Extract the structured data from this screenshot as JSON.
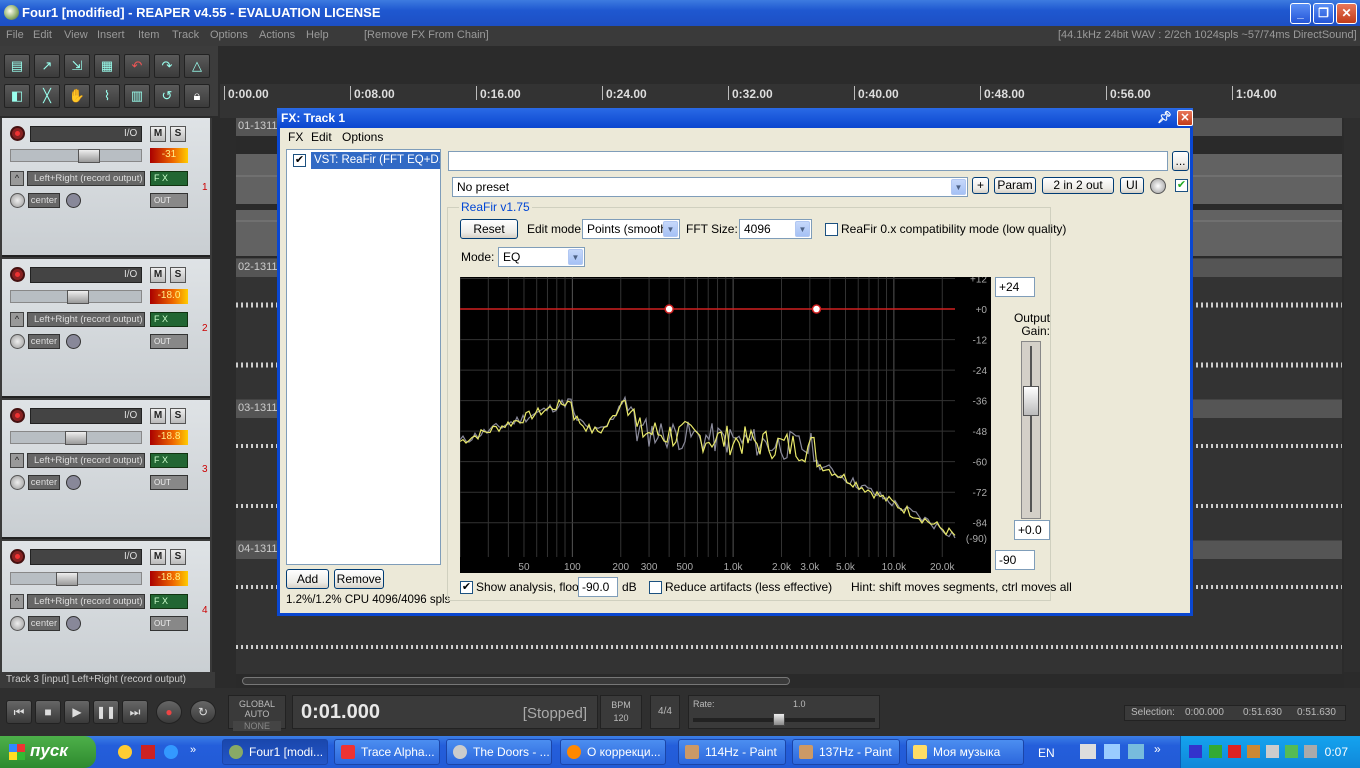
{
  "window": {
    "title": "Four1 [modified] - REAPER v4.55 - EVALUATION LICENSE"
  },
  "menu": {
    "items": [
      "File",
      "Edit",
      "View",
      "Insert",
      "Item",
      "Track",
      "Options",
      "Actions",
      "Help"
    ],
    "last_action": "[Remove FX From Chain]",
    "status": "[44.1kHz 24bit WAV : 2/2ch 1024spls ~57/74ms DirectSound]"
  },
  "ruler": {
    "ticks": [
      "0:00.00",
      "0:08.00",
      "0:16.00",
      "0:24.00",
      "0:32.00",
      "0:40.00",
      "0:48.00",
      "0:56.00",
      "1:04.00"
    ]
  },
  "clips": [
    "01-1311",
    "02-1311",
    "03-1311",
    "04-1311"
  ],
  "tracks": [
    {
      "num": "1",
      "io": "I/O",
      "mute": "M",
      "solo": "S",
      "vu": "-31",
      "routing": "Left+Right (record output)",
      "fx": "F X",
      "pan": "center",
      "out": "OUT",
      "fader": 0.62
    },
    {
      "num": "2",
      "io": "I/O",
      "mute": "M",
      "solo": "S",
      "vu": "-18.0",
      "routing": "Left+Right (record output)",
      "fx": "F X",
      "pan": "center",
      "out": "OUT",
      "fader": 0.52
    },
    {
      "num": "3",
      "io": "I/O",
      "mute": "M",
      "solo": "S",
      "vu": "-18.8",
      "routing": "Left+Right (record output)",
      "fx": "F X",
      "pan": "center",
      "out": "OUT",
      "fader": 0.5
    },
    {
      "num": "4",
      "io": "I/O",
      "mute": "M",
      "solo": "S",
      "vu": "-18.8",
      "routing": "Left+Right (record output)",
      "fx": "F X",
      "pan": "center",
      "out": "OUT",
      "fader": 0.42
    }
  ],
  "track_status": "Track 3 [input] Left+Right (record output)",
  "transport": {
    "time": "0:01.000",
    "state": "[Stopped]",
    "bpm_label": "BPM",
    "bpm": "120",
    "timesig": "4/4",
    "rate_label": "Rate:",
    "rate": "1.0",
    "global_auto": "GLOBAL AUTO",
    "global_auto_val": "NONE",
    "sel_label": "Selection:",
    "sel_start": "0:00.000",
    "sel_end": "0:51.630",
    "sel_len": "0:51.630"
  },
  "fx": {
    "title": "FX: Track 1",
    "menu": [
      "FX",
      "Edit",
      "Options"
    ],
    "chain_item": "VST: ReaFir (FFT EQ+D...",
    "add": "Add",
    "remove": "Remove",
    "cpu": "1.2%/1.2% CPU 4096/4096 spls",
    "more": "...",
    "preset": "No preset",
    "plus": "+",
    "param": "Param",
    "io": "2 in 2 out",
    "ui": "UI",
    "plugin_name": "ReaFir v1.75",
    "reset": "Reset",
    "edit_mode_label": "Edit mode:",
    "edit_mode": "Points (smooth)",
    "fft_label": "FFT Size:",
    "fft": "4096",
    "compat_label": "ReaFir 0.x compatibility mode (low quality)",
    "mode_label": "Mode:",
    "mode": "EQ",
    "top_db": "+24",
    "output_gain_label": "Output Gain:",
    "gain_val": "+0.0",
    "floor_box": "-90",
    "show_analysis": "Show analysis, floor:",
    "floor": "-90.0",
    "db": "dB",
    "reduce_artifacts": "Reduce artifacts (less effective)",
    "hint": "Hint: shift moves segments, ctrl moves all",
    "db_labels": [
      "+12",
      "+0",
      "-12",
      "-24",
      "-36",
      "-48",
      "-60",
      "-72",
      "-84",
      "(-90)"
    ],
    "freq_labels": [
      "50",
      "100",
      "200",
      "300",
      "500",
      "1.0k",
      "2.0k",
      "3.0k",
      "5.0k",
      "10.0k",
      "20.0k"
    ]
  },
  "taskbar": {
    "start": "пуск",
    "tasks": [
      "Four1 [modi...",
      "Trace Alpha...",
      "The Doors - ...",
      "О коррекци...",
      "114Hz - Paint",
      "137Hz - Paint",
      "Моя музыка"
    ],
    "lang": "EN",
    "clock": "0:07"
  }
}
